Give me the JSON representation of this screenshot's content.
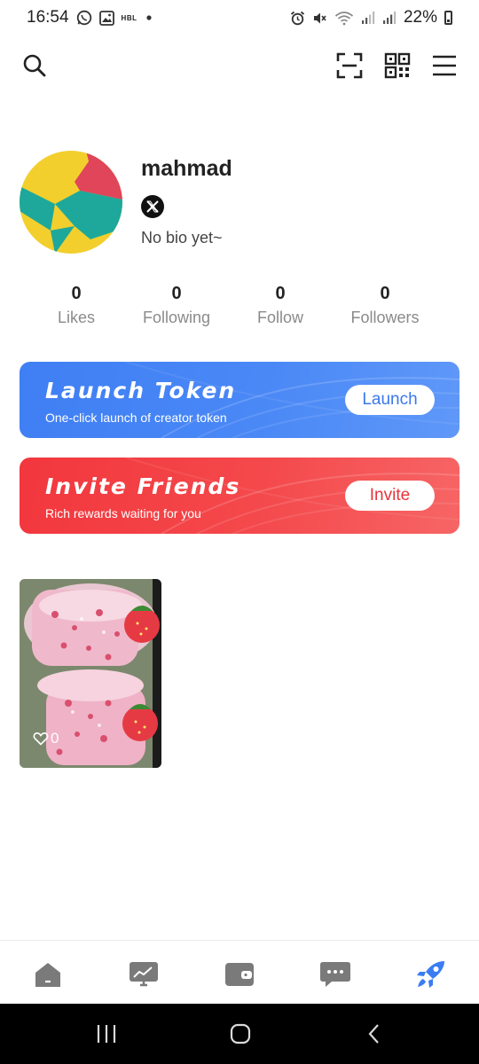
{
  "status_bar": {
    "time": "16:54",
    "carrier_tag": "HBL",
    "battery": "22%"
  },
  "profile": {
    "username": "mahmad",
    "bio": "No bio yet~"
  },
  "stats": [
    {
      "value": "0",
      "label": "Likes"
    },
    {
      "value": "0",
      "label": "Following"
    },
    {
      "value": "0",
      "label": "Follow"
    },
    {
      "value": "0",
      "label": "Followers"
    }
  ],
  "banners": {
    "launch": {
      "title": "Launch Token",
      "subtitle": "One-click launch of creator token",
      "button": "Launch",
      "color": "#3f7ff4"
    },
    "invite": {
      "title": "Invite Friends",
      "subtitle": "Rich rewards waiting for you",
      "button": "Invite",
      "color": "#f2373d"
    }
  },
  "posts": [
    {
      "likes": "0"
    }
  ],
  "bottom_nav": {
    "items": [
      "home-icon",
      "chart-icon",
      "wallet-icon",
      "message-icon",
      "rocket-icon"
    ],
    "active_index": 4,
    "active_color": "#3b7cf3",
    "inactive_color": "#7a7a7a"
  }
}
